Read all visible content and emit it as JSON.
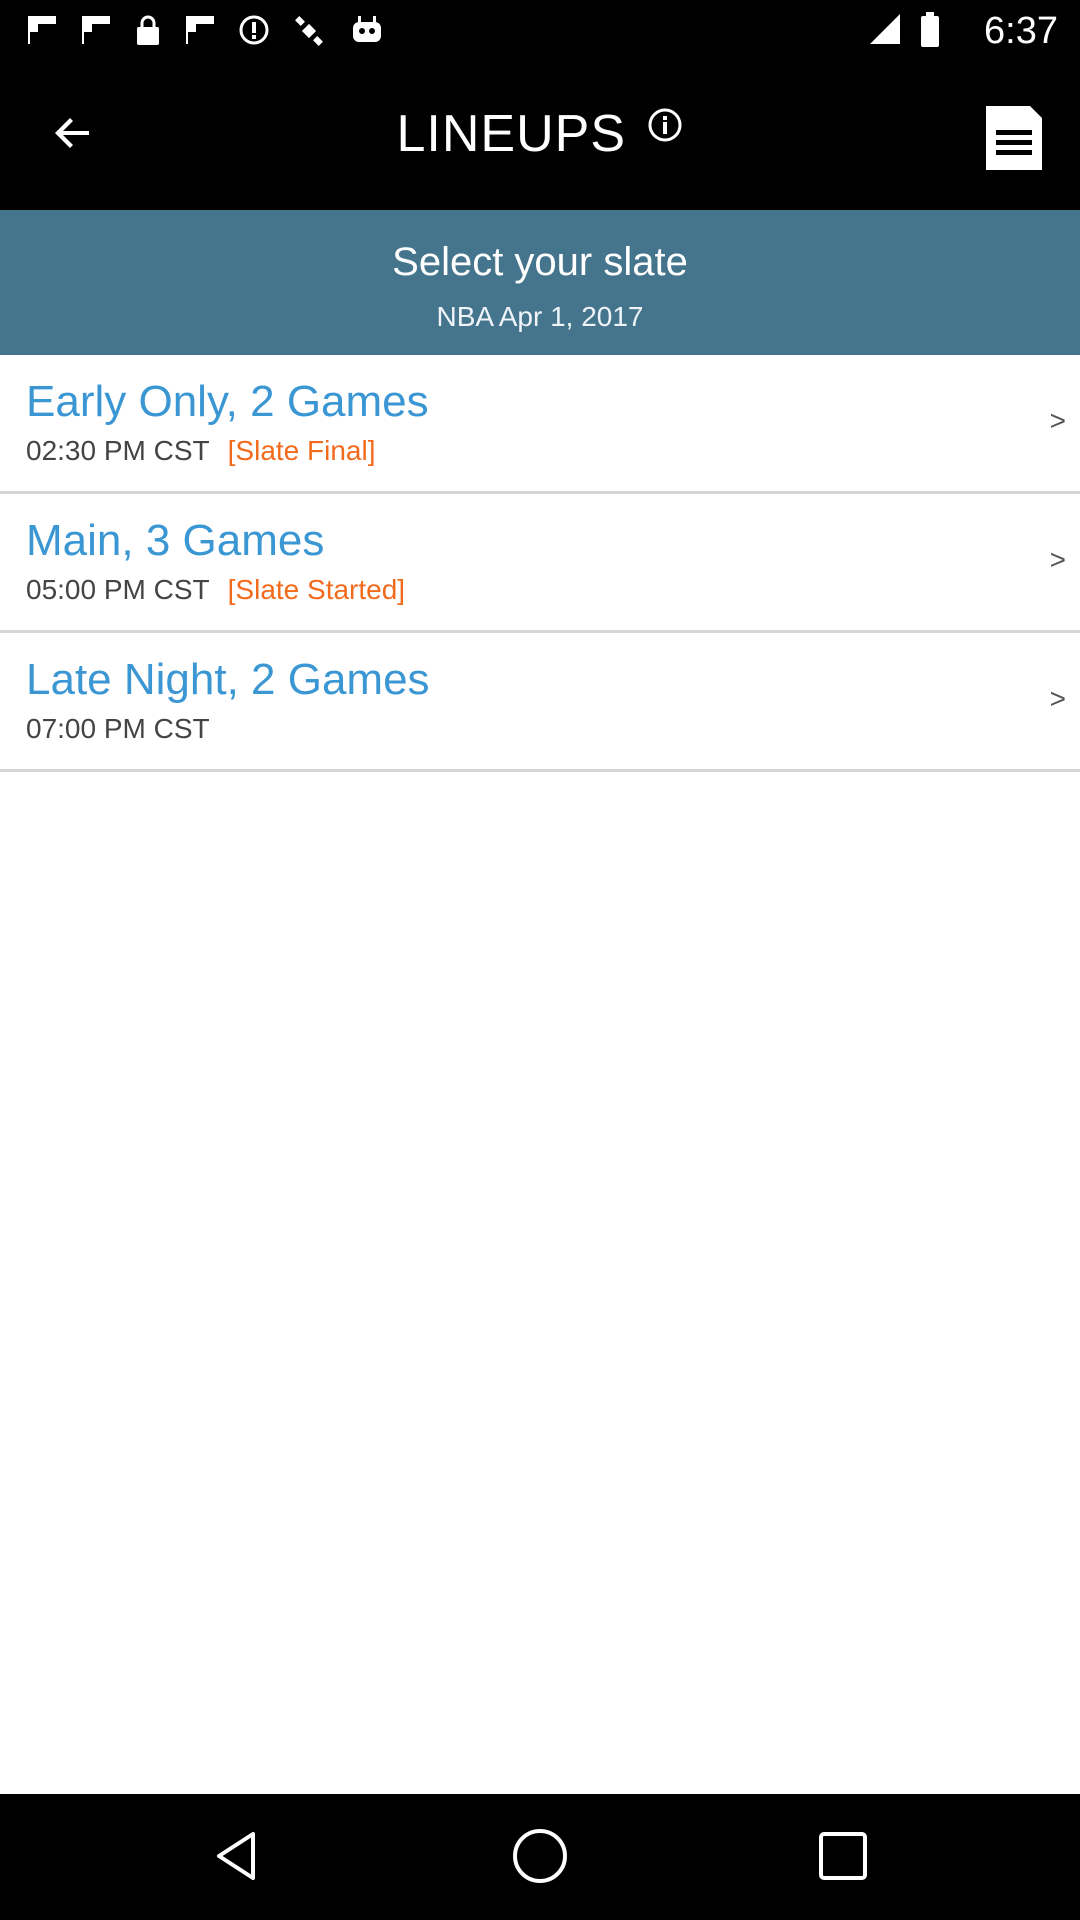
{
  "status_bar": {
    "time": "6:37",
    "icons": [
      "flipboard-icon",
      "flipboard-icon",
      "lock-icon",
      "flipboard-icon",
      "circle-info-icon",
      "satellite-icon",
      "robot-icon"
    ]
  },
  "app_bar": {
    "title": "LINEUPS",
    "back_icon": "arrow-back-icon",
    "info_icon": "info-icon",
    "menu_icon": "document-list-icon"
  },
  "header": {
    "title": "Select your slate",
    "subtitle": "NBA Apr 1, 2017"
  },
  "slates": [
    {
      "name": "Early Only, 2 Games",
      "time": "02:30 PM CST",
      "status": "[Slate Final]",
      "chevron": ">"
    },
    {
      "name": "Main, 3 Games",
      "time": "05:00 PM CST",
      "status": "[Slate Started]",
      "chevron": ">"
    },
    {
      "name": "Late Night, 2 Games",
      "time": "07:00 PM CST",
      "status": "",
      "chevron": ">"
    }
  ],
  "colors": {
    "header_band": "#45748d",
    "slate_name": "#3b97d3",
    "slate_status": "#f26b1d"
  },
  "nav_bar": {
    "icons": [
      "back-triangle-icon",
      "home-circle-icon",
      "recents-square-icon"
    ]
  }
}
